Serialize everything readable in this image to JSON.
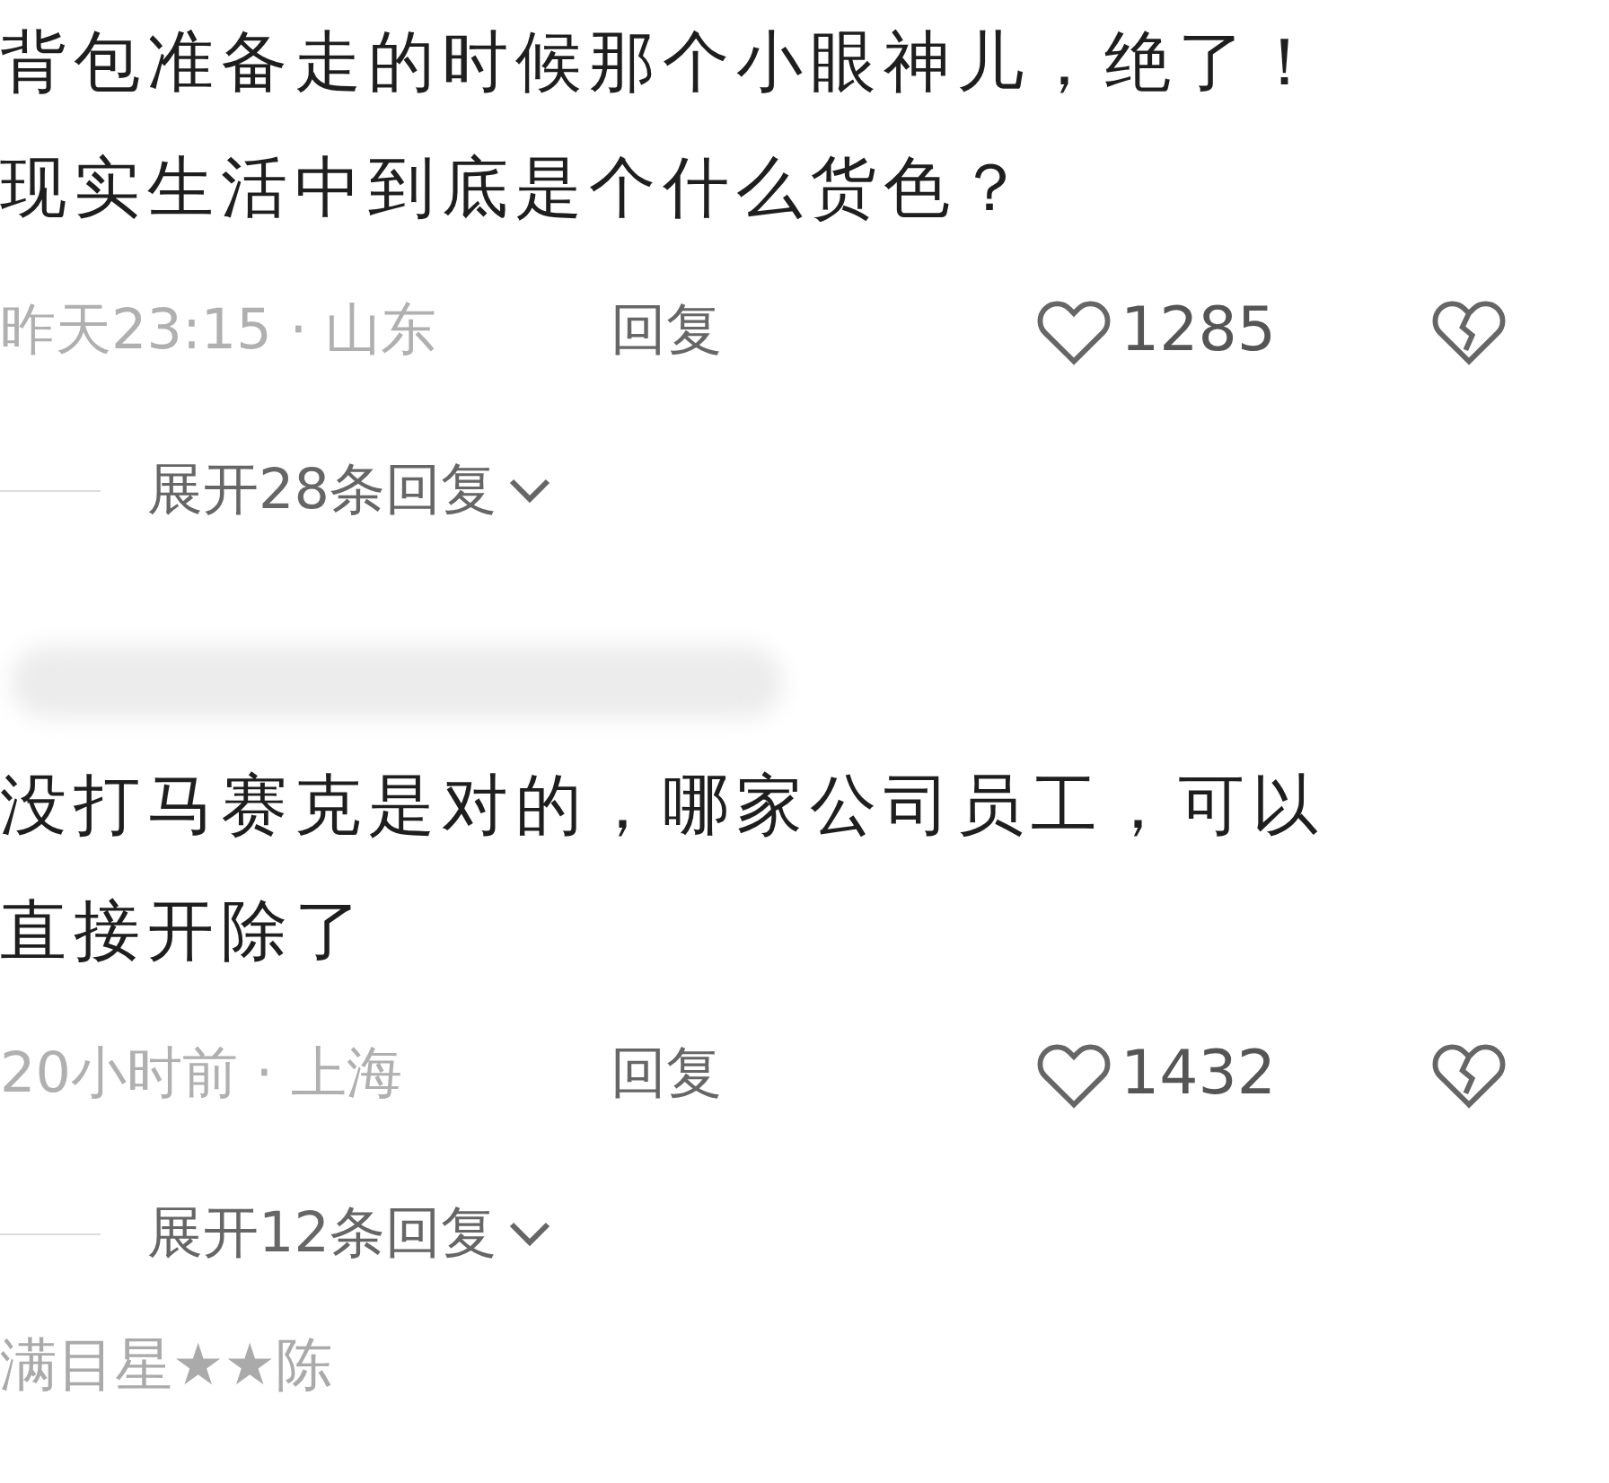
{
  "comments": [
    {
      "lines": [
        "背包准备走的时候那个小眼神儿，绝了！",
        "现实生活中到底是个什么货色？"
      ],
      "meta": "昨天23:15 · 山东",
      "reply": "回复",
      "likes": "1285",
      "expand": "展开28条回复"
    },
    {
      "name_blurred": true,
      "lines": [
        "没打马赛克是对的，哪家公司员工，可以",
        "直接开除了"
      ],
      "meta": "20小时前 · 上海",
      "reply": "回复",
      "likes": "1432",
      "expand": "展开12条回复"
    },
    {
      "name": "满目星★★陈"
    }
  ]
}
